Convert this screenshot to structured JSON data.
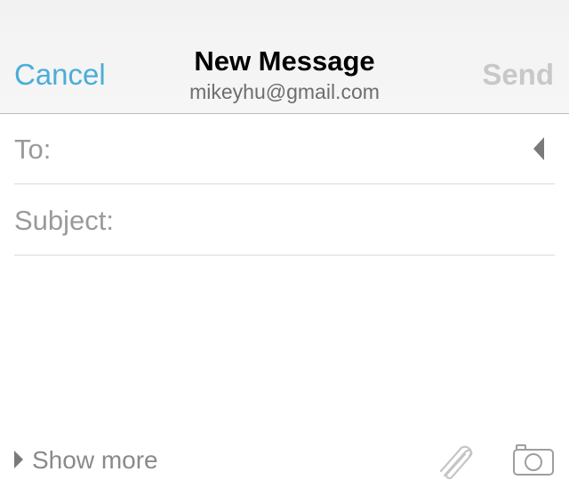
{
  "header": {
    "cancel_label": "Cancel",
    "title": "New Message",
    "account": "mikeyhu@gmail.com",
    "send_label": "Send"
  },
  "to_field": {
    "label": "To:",
    "value": ""
  },
  "subject_field": {
    "label": "Subject:",
    "value": ""
  },
  "body": {
    "value": ""
  },
  "footer": {
    "show_more_label": "Show more",
    "attach_icon": "paperclip-icon",
    "camera_icon": "camera-icon"
  },
  "colors": {
    "accent": "#4aaed8",
    "disabled": "#c8c8c8",
    "placeholder": "#9a9a9a"
  }
}
